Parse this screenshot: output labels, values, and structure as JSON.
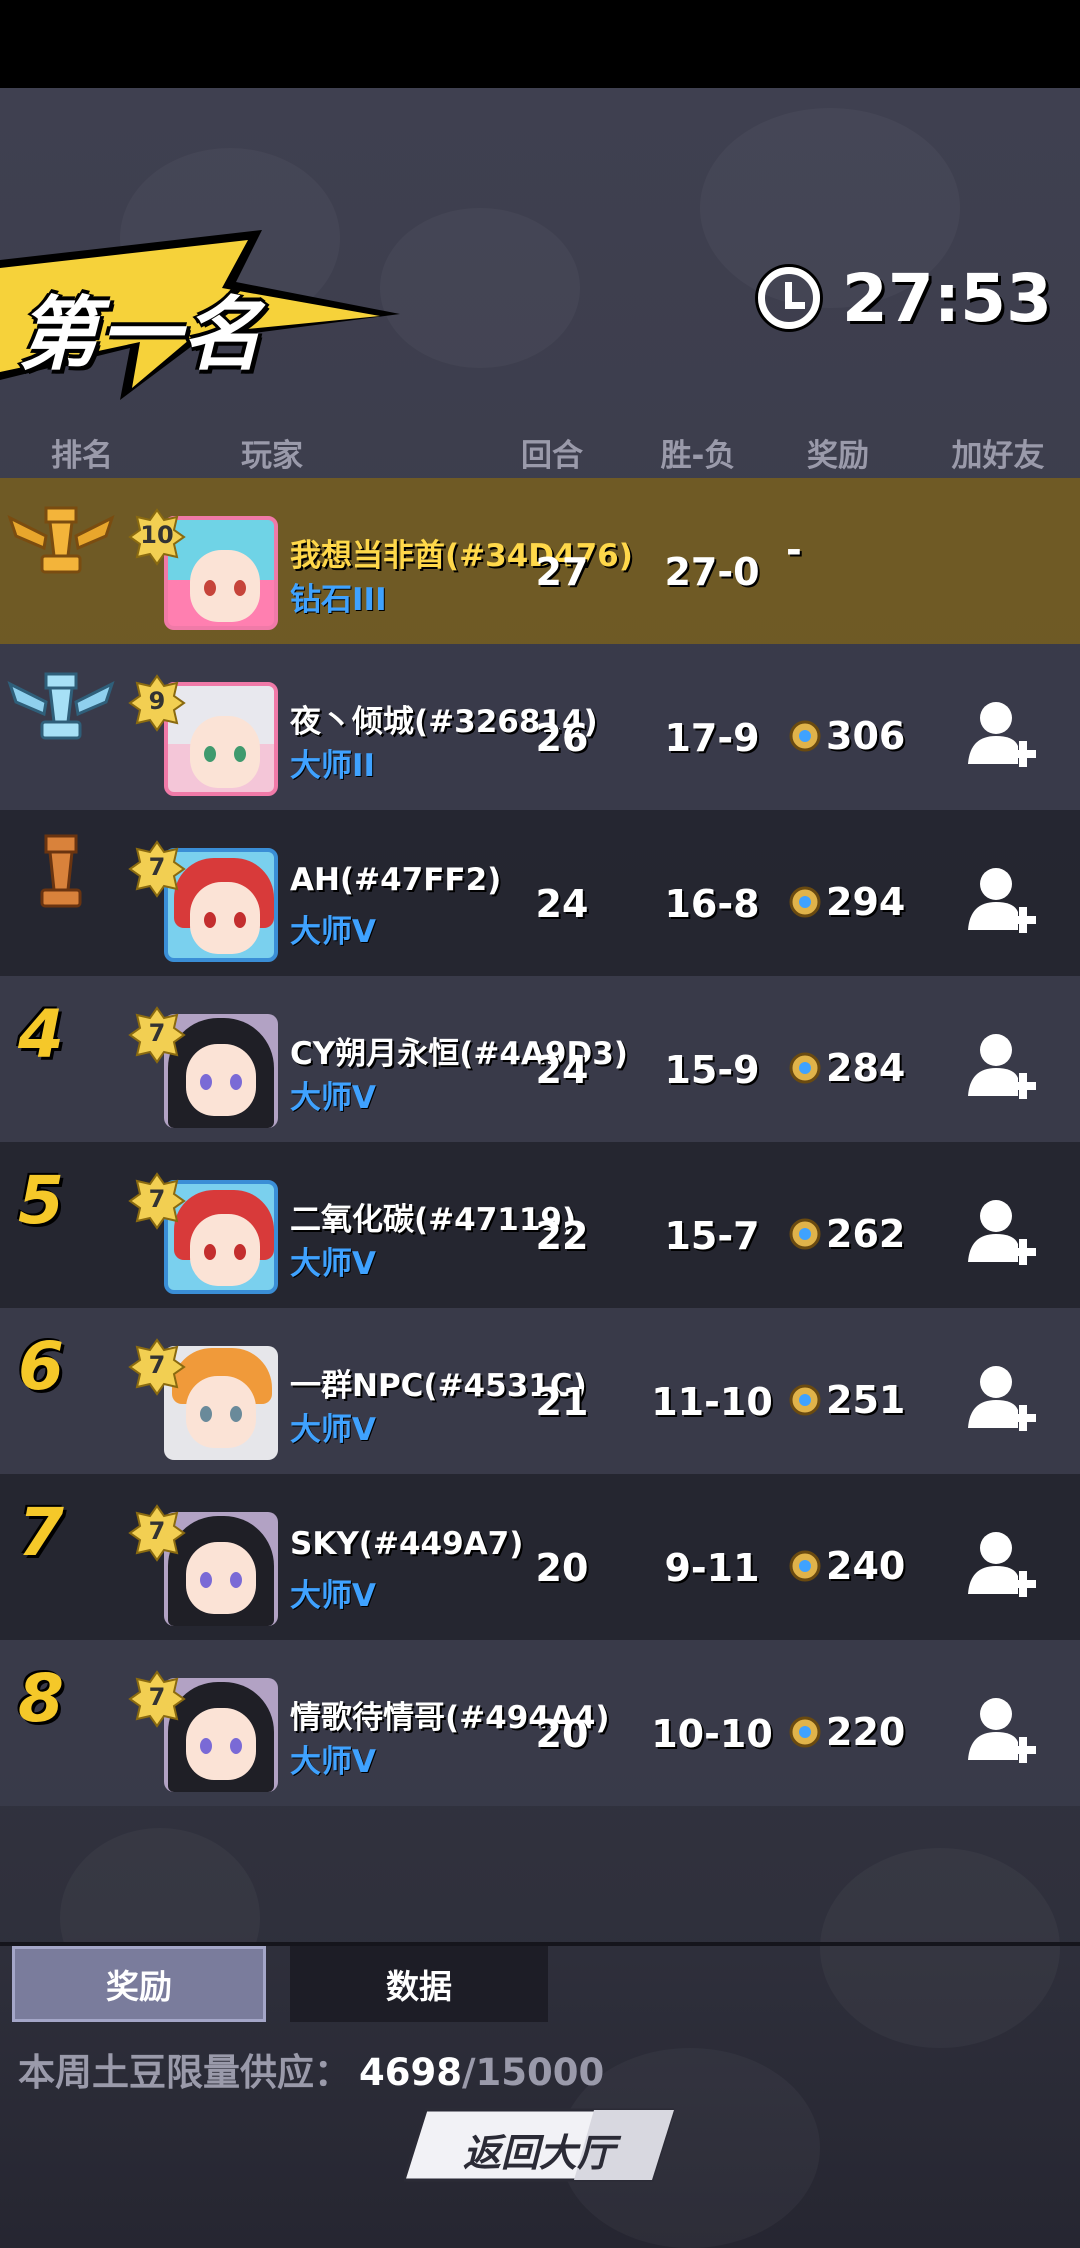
{
  "header": {
    "placement_title": "第一名",
    "timer": "27:53"
  },
  "columns": {
    "rank": "排名",
    "player": "玩家",
    "rounds": "回合",
    "record": "胜-负",
    "reward": "奖励",
    "add_friend": "加好友"
  },
  "players": [
    {
      "rank": "1",
      "trophy": "gold",
      "level": "10",
      "name": "我想当非酋(#34D476)",
      "tier": "钻石III",
      "rounds": "27",
      "record": "27-0",
      "reward": "-",
      "is_self": true
    },
    {
      "rank": "2",
      "trophy": "silver",
      "level": "9",
      "name": "夜丶倾城(#326814)",
      "tier": "大师II",
      "rounds": "26",
      "record": "17-9",
      "reward": "306"
    },
    {
      "rank": "3",
      "trophy": "bronze",
      "level": "7",
      "name": "AH(#47FF2)",
      "tier": "大师V",
      "rounds": "24",
      "record": "16-8",
      "reward": "294"
    },
    {
      "rank": "4",
      "level": "7",
      "name": "CY朔月永恒(#4A9D3)",
      "tier": "大师V",
      "rounds": "24",
      "record": "15-9",
      "reward": "284"
    },
    {
      "rank": "5",
      "level": "7",
      "name": "二氧化碳(#47119)",
      "tier": "大师V",
      "rounds": "22",
      "record": "15-7",
      "reward": "262"
    },
    {
      "rank": "6",
      "level": "7",
      "name": "一群NPC(#4531C)",
      "tier": "大师V",
      "rounds": "21",
      "record": "11-10",
      "reward": "251"
    },
    {
      "rank": "7",
      "level": "7",
      "name": "SKY(#449A7)",
      "tier": "大师V",
      "rounds": "20",
      "record": "9-11",
      "reward": "240"
    },
    {
      "rank": "8",
      "level": "7",
      "name": "情歌待情哥(#494A4)",
      "tier": "大师V",
      "rounds": "20",
      "record": "10-10",
      "reward": "220"
    }
  ],
  "tabs": {
    "reward": "奖励",
    "data": "数据"
  },
  "supply": {
    "label": "本周土豆限量供应：",
    "current": "4698",
    "max": "/15000"
  },
  "back_button": "返回大厅",
  "colors": {
    "highlight_row": "#785f1e",
    "tier_blue": "#3fa2ff",
    "rank_yellow": "#f5c829",
    "banner_yellow": "#f6d23a"
  }
}
